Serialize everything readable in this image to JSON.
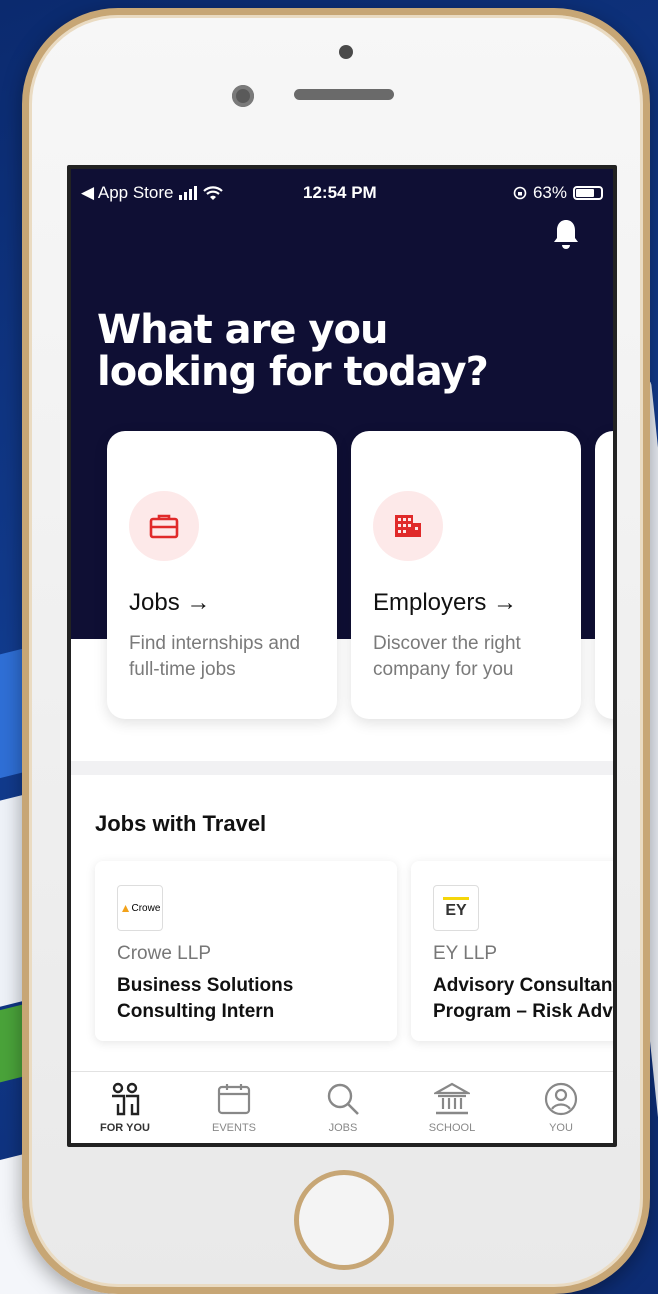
{
  "status_bar": {
    "back_label": "◀ App Store",
    "time": "12:54 PM",
    "battery": "63%"
  },
  "hero": {
    "headline_line1": "What are you",
    "headline_line2": "looking for today?"
  },
  "cards": [
    {
      "title": "Jobs →",
      "description": "Find internships and full-time jobs",
      "icon": "briefcase-icon"
    },
    {
      "title": "Employers →",
      "description": "Discover the right company for you",
      "icon": "building-icon"
    }
  ],
  "section": {
    "title": "Jobs with Travel"
  },
  "jobs": [
    {
      "logo_text": "Crowe",
      "company": "Crowe LLP",
      "role_line1": "Business Solutions",
      "role_line2": "Consulting Intern"
    },
    {
      "logo_text": "EY",
      "company": "EY LLP",
      "role_line1": "Advisory Consultant",
      "role_line2": "Program – Risk Advisory"
    }
  ],
  "tabs": [
    {
      "label": "FOR YOU",
      "icon": "for-you-icon",
      "active": true
    },
    {
      "label": "EVENTS",
      "icon": "calendar-icon",
      "active": false
    },
    {
      "label": "JOBS",
      "icon": "search-icon",
      "active": false
    },
    {
      "label": "SCHOOL",
      "icon": "school-icon",
      "active": false
    },
    {
      "label": "YOU",
      "icon": "profile-icon",
      "active": false
    }
  ],
  "colors": {
    "hero_bg": "#0f0f34",
    "accent": "#e02a2a",
    "badge_bg": "#fde9e9"
  }
}
